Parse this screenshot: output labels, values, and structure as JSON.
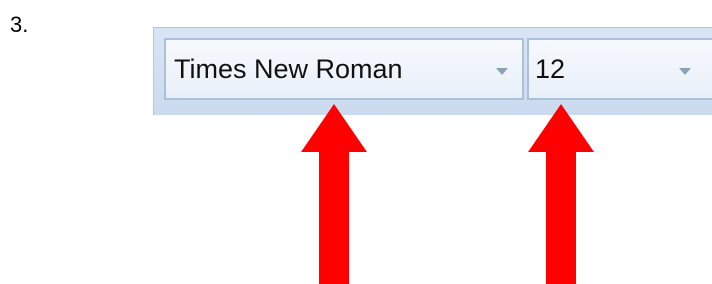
{
  "step_number": "3.",
  "toolbar": {
    "font_combo": {
      "value": "Times New Roman",
      "icon": "chevron-down-icon"
    },
    "size_combo": {
      "value": "12",
      "icon": "chevron-down-icon"
    }
  },
  "annotations": {
    "arrow_color": "#ff0000"
  }
}
